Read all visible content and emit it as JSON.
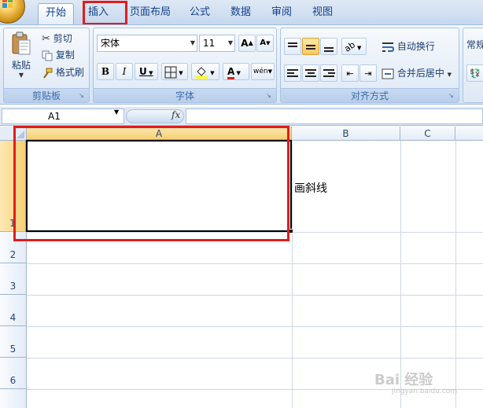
{
  "tabs": [
    {
      "label": "开始",
      "active": true
    },
    {
      "label": "插入",
      "active": false,
      "highlighted": true
    },
    {
      "label": "页面布局",
      "active": false
    },
    {
      "label": "公式",
      "active": false
    },
    {
      "label": "数据",
      "active": false
    },
    {
      "label": "审阅",
      "active": false
    },
    {
      "label": "视图",
      "active": false
    }
  ],
  "ribbon": {
    "clipboard": {
      "group_label": "剪贴板",
      "paste": "粘贴",
      "cut": "剪切",
      "copy": "复制",
      "format_painter": "格式刷"
    },
    "font": {
      "group_label": "字体",
      "font_name": "宋体",
      "font_size": "11",
      "bold": "B",
      "italic": "I",
      "underline": "U",
      "grow": "A",
      "shrink": "A",
      "font_color_letter": "A",
      "phonetic": "wén"
    },
    "alignment": {
      "group_label": "对齐方式",
      "wrap_text": "自动换行",
      "merge_center": "合并后居中"
    },
    "number": {
      "format_name": "常规"
    }
  },
  "formula_bar": {
    "name_box": "A1",
    "fx": "fx",
    "formula": ""
  },
  "grid": {
    "columns": [
      "A",
      "B",
      "C"
    ],
    "rows": [
      "1",
      "2",
      "3",
      "4",
      "5",
      "6"
    ],
    "selected_cell": "A1",
    "cells": {
      "B1": "画斜线"
    }
  },
  "watermark": {
    "main": "Bai 经验",
    "sub": "jingyan.baidu.com"
  },
  "colors": {
    "accent_red": "#e01d1d",
    "selection_orange": "#f8cf74",
    "ribbon_blue": "#15428b"
  }
}
